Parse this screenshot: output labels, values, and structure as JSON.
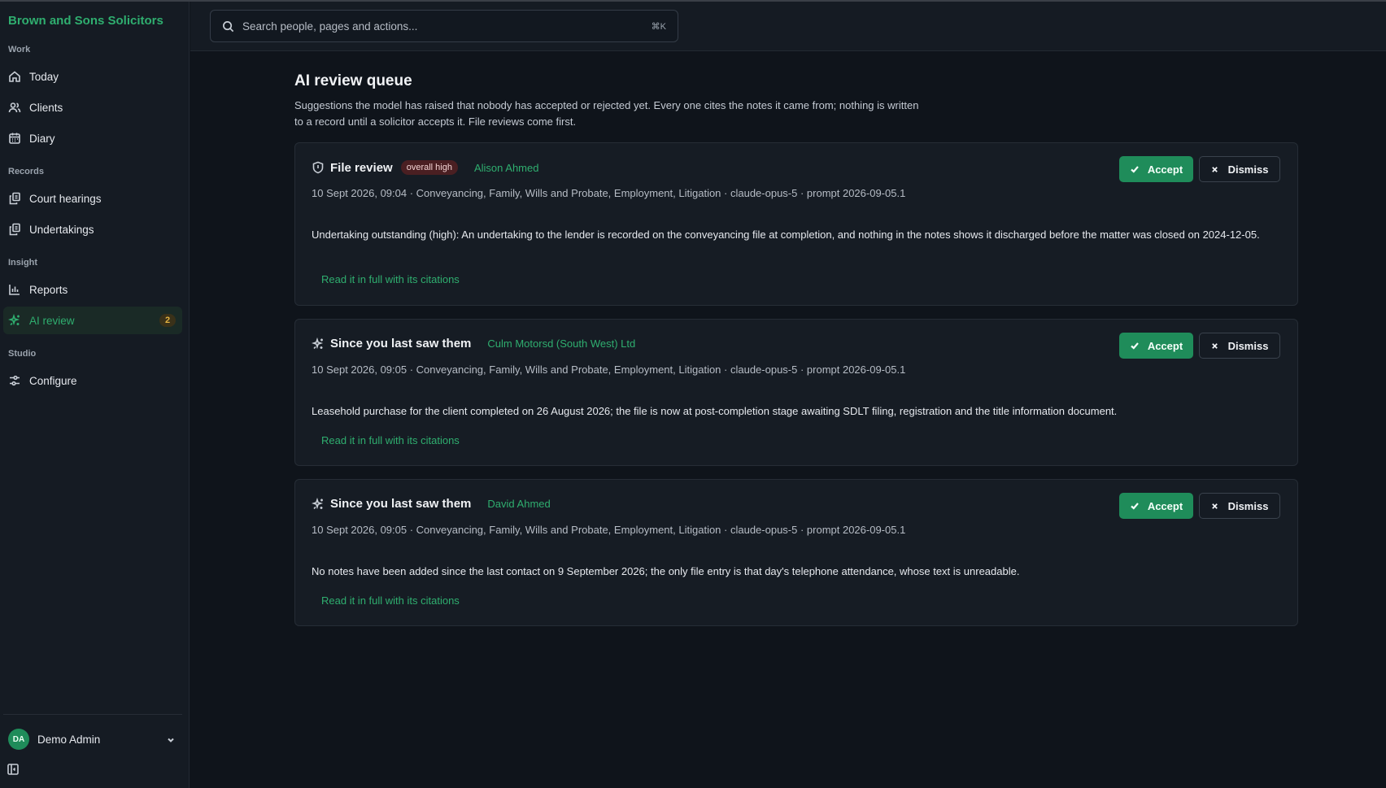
{
  "brand": "Brown and Sons Solicitors",
  "sidebar": {
    "sections": [
      {
        "label": "Work"
      },
      {
        "label": "Records"
      },
      {
        "label": "Insight"
      },
      {
        "label": "Studio"
      }
    ],
    "items": [
      {
        "label": "Today",
        "icon": "home-icon"
      },
      {
        "label": "Clients",
        "icon": "users-icon"
      },
      {
        "label": "Diary",
        "icon": "calendar-icon"
      },
      {
        "label": "Court hearings",
        "icon": "documents-icon"
      },
      {
        "label": "Undertakings",
        "icon": "documents-icon"
      },
      {
        "label": "Reports",
        "icon": "bar-chart-icon"
      },
      {
        "label": "AI review",
        "icon": "sparkles-icon",
        "active": true,
        "badge": "2"
      },
      {
        "label": "Configure",
        "icon": "sliders-icon"
      }
    ],
    "user": {
      "initials": "DA",
      "name": "Demo Admin"
    }
  },
  "header": {
    "search_placeholder": "Search people, pages and actions...",
    "shortcut": "⌘K"
  },
  "main": {
    "title": "AI review queue",
    "description": "Suggestions the model has raised that nobody has accepted or rejected yet. Every one cites the notes it came from; nothing is written to a record until a solicitor accepts it. File reviews come first.",
    "accept_label": "Accept",
    "dismiss_label": "Dismiss",
    "cards": [
      {
        "icon": "shield-icon",
        "title": "File review",
        "severity": "overall high",
        "client": "Alison Ahmed",
        "meta": "10 Sept 2026, 09:04 · Conveyancing, Family, Wills and Probate, Employment, Litigation · claude-opus-5 · prompt 2026-09-05.1",
        "body": "Undertaking outstanding (high): An undertaking to the lender is recorded on the conveyancing file at completion, and nothing in the notes shows it discharged before the matter was closed on 2024-12-05.",
        "link": "Read it in full with its citations"
      },
      {
        "icon": "sparkles-icon",
        "title": "Since you last saw them",
        "client": "Culm Motorsd (South West) Ltd",
        "meta": "10 Sept 2026, 09:05 · Conveyancing, Family, Wills and Probate, Employment, Litigation · claude-opus-5 · prompt 2026-09-05.1",
        "body": "Leasehold purchase for the client completed on 26 August 2026; the file is now at post-completion stage awaiting SDLT filing, registration and the title information document.",
        "link": "Read it in full with its citations"
      },
      {
        "icon": "sparkles-icon",
        "title": "Since you last saw them",
        "client": "David Ahmed",
        "meta": "10 Sept 2026, 09:05 · Conveyancing, Family, Wills and Probate, Employment, Litigation · claude-opus-5 · prompt 2026-09-05.1",
        "body": "No notes have been added since the last contact on 9 September 2026; the only file entry is that day's telephone attendance, whose text is unreadable.",
        "link": "Read it in full with its citations"
      }
    ]
  }
}
